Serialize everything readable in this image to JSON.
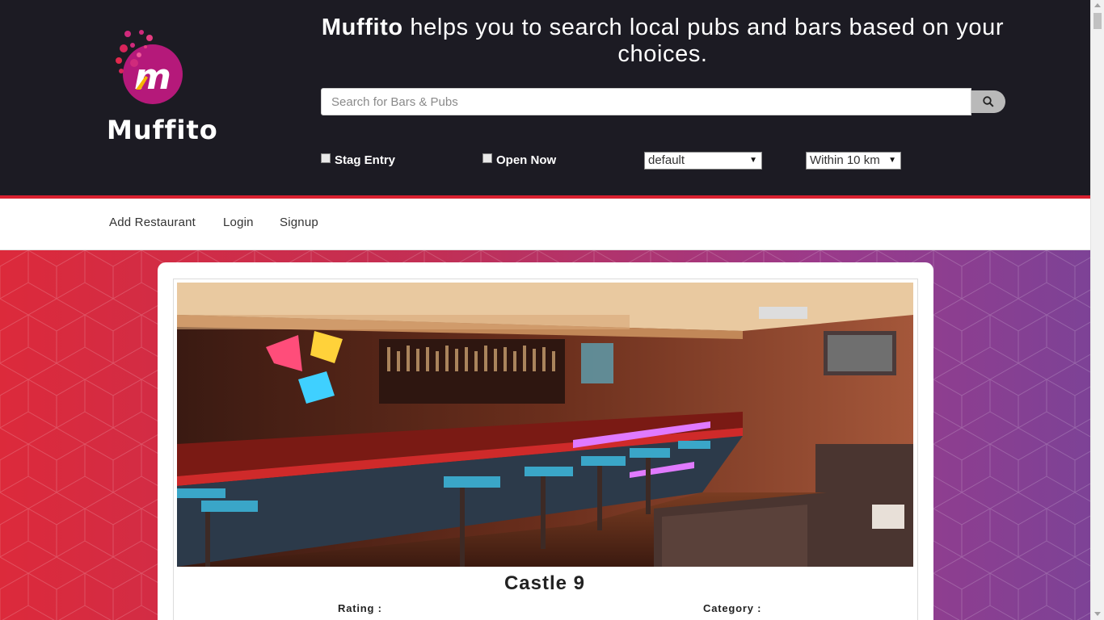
{
  "brand": {
    "name": "Muffito",
    "logo_letter": "m"
  },
  "header": {
    "tagline_brand": "Muffito",
    "tagline_rest": " helps you to search local pubs and bars based on your choices."
  },
  "search": {
    "placeholder": "Search for Bars & Pubs",
    "icon": "search-icon"
  },
  "filters": {
    "stag_entry": "Stag Entry",
    "open_now": "Open Now",
    "sort_selected": "default",
    "distance_selected": "Within 10 km"
  },
  "nav": {
    "add_restaurant": "Add Restaurant",
    "login": "Login",
    "signup": "Signup"
  },
  "restaurant": {
    "name": "Castle 9",
    "rating_label": "Rating :",
    "category_label": "Category :"
  },
  "colors": {
    "header_bg": "#1c1b23",
    "accent_red": "#d8202f",
    "logo_magenta": "#b5197a",
    "bg_gradient_start": "#dc2a3b",
    "bg_gradient_end": "#7d4296"
  }
}
